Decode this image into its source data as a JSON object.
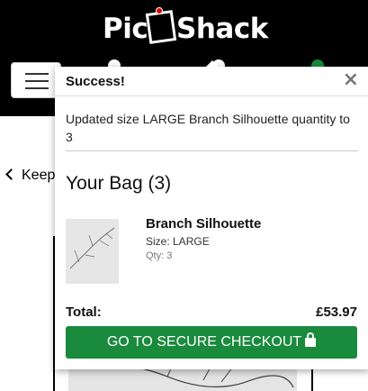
{
  "header": {
    "logo_left": "Pic",
    "logo_right": "Shack",
    "menu_label": "Menu"
  },
  "page": {
    "keep_link_label": "Keep"
  },
  "popup": {
    "title": "Success!",
    "close_label": "×",
    "message": "Updated size LARGE Branch Silhouette quantity to 3",
    "bag_title": "Your Bag (3)",
    "item": {
      "name": "Branch Silhouette",
      "size": "Size: LARGE",
      "qty": "Qty: 3"
    },
    "total_label": "Total:",
    "total_value": "£53.97",
    "checkout_label": "GO TO SECURE CHECKOUT"
  },
  "colors": {
    "header_bg": "#000000",
    "checkout_green": "#1a8a3c",
    "logo_pin": "#e00000"
  },
  "icons": [
    "menu-icon",
    "close-icon",
    "chevron-left-icon",
    "lock-icon",
    "user-icon",
    "bag-icon"
  ]
}
